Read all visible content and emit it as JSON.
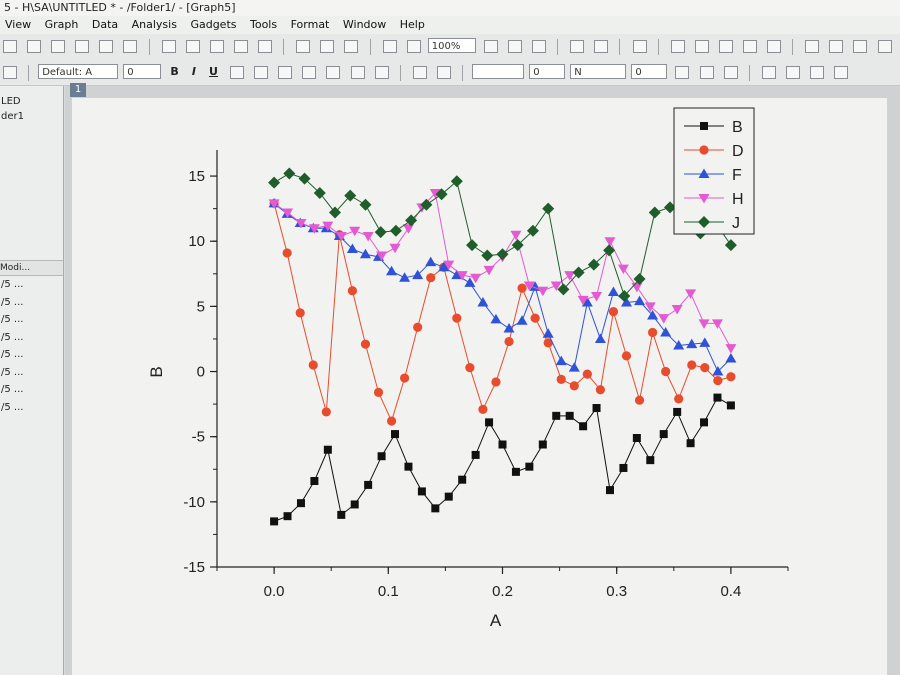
{
  "window": {
    "title": "5 - H\\SA\\UNTITLED * - /Folder1/ - [Graph5]"
  },
  "menu": [
    "View",
    "Graph",
    "Data",
    "Analysis",
    "Gadgets",
    "Tools",
    "Format",
    "Window",
    "Help"
  ],
  "toolbar": {
    "zoom": "100%",
    "font": "Default: A",
    "font_size": "0",
    "bold": "B",
    "italic": "I",
    "underline": "U",
    "line_style_value": "0",
    "line_width_value": "0",
    "color_value": "N"
  },
  "project_explorer": {
    "items": [
      "LED",
      "der1"
    ],
    "header": "Modi...",
    "rows": [
      "/5 ...",
      "/5 ...",
      "/5 ...",
      "/5 ...",
      "/5 ...",
      "/5 ...",
      "/5 ...",
      "/5 ..."
    ]
  },
  "graph": {
    "layer_tab": "1"
  },
  "chart_data": {
    "type": "scatter",
    "xlabel": "A",
    "ylabel": "B",
    "xlim": [
      -0.05,
      0.45
    ],
    "ylim": [
      -15,
      17
    ],
    "xticks": [
      0.0,
      0.1,
      0.2,
      0.3,
      0.4
    ],
    "xtick_labels": [
      "0.0",
      "0.1",
      "0.2",
      "0.3",
      "0.4"
    ],
    "yticks": [
      -15,
      -10,
      -5,
      0,
      5,
      10,
      15
    ],
    "ytick_labels": [
      "-15",
      "-10",
      "-5",
      "0",
      "5",
      "10",
      "15"
    ],
    "x": [
      0.0,
      0.0133,
      0.0267,
      0.04,
      0.0533,
      0.0667,
      0.08,
      0.0933,
      0.1067,
      0.12,
      0.1333,
      0.1467,
      0.16,
      0.1733,
      0.1867,
      0.2,
      0.2133,
      0.2267,
      0.24,
      0.2533,
      0.2667,
      0.28,
      0.2933,
      0.3067,
      0.32,
      0.3333,
      0.3467,
      0.36,
      0.3733,
      0.3867,
      0.4
    ],
    "legend_position": "top-right",
    "grid": false,
    "series": [
      {
        "name": "B",
        "color": "#111111",
        "marker": "square",
        "values": [
          -11.5,
          -11.1,
          -10.1,
          -8.4,
          -6.0,
          -11.0,
          -10.2,
          -8.7,
          -6.5,
          -4.8,
          -7.3,
          -9.2,
          -10.5,
          -9.6,
          -8.3,
          -6.4,
          -3.9,
          -5.6,
          -7.7,
          -7.3,
          -5.6,
          -3.4,
          -3.4,
          -4.2,
          -2.8,
          -9.1,
          -7.4,
          -5.1,
          -6.8,
          -4.8,
          -3.1,
          -5.5,
          -3.9,
          -2.0,
          -2.6
        ]
      },
      {
        "name": "D",
        "color": "#e74c2c",
        "marker": "circle",
        "values": [
          12.9,
          9.1,
          4.5,
          0.5,
          -3.1,
          10.5,
          6.2,
          2.1,
          -1.6,
          -3.8,
          -0.5,
          3.4,
          7.2,
          8.0,
          4.1,
          0.3,
          -2.9,
          -0.8,
          2.3,
          6.4,
          4.1,
          2.2,
          -0.6,
          -1.1,
          -0.2,
          -1.4,
          4.6,
          1.2,
          -2.2,
          3.0,
          0.0,
          -2.1,
          0.5,
          0.3,
          -0.7,
          -0.4
        ]
      },
      {
        "name": "F",
        "color": "#2f52d6",
        "marker": "triangle-up",
        "values": [
          12.9,
          12.1,
          11.4,
          11.0,
          11.0,
          10.4,
          9.4,
          9.0,
          8.8,
          7.7,
          7.2,
          7.4,
          8.4,
          8.0,
          7.4,
          6.8,
          5.3,
          4.0,
          3.3,
          3.9,
          6.5,
          2.9,
          0.8,
          0.3,
          5.3,
          2.5,
          6.1,
          5.3,
          5.4,
          4.3,
          3.0,
          2.0,
          2.1,
          2.2,
          0.0,
          1.0
        ]
      },
      {
        "name": "H",
        "color": "#e45ad0",
        "marker": "triangle-down",
        "values": [
          12.9,
          12.2,
          11.4,
          11.0,
          11.2,
          10.4,
          10.8,
          10.4,
          8.9,
          9.5,
          11.0,
          12.6,
          13.7,
          8.2,
          7.4,
          7.2,
          7.8,
          8.8,
          10.5,
          6.6,
          6.2,
          6.6,
          7.4,
          5.5,
          5.8,
          10.0,
          7.9,
          6.5,
          5.0,
          4.1,
          4.8,
          6.0,
          3.7,
          3.7,
          1.8
        ]
      },
      {
        "name": "J",
        "color": "#1f5d2b",
        "marker": "diamond",
        "values": [
          14.5,
          15.2,
          14.8,
          13.7,
          12.2,
          13.5,
          12.8,
          10.7,
          10.8,
          11.6,
          12.8,
          13.6,
          14.6,
          9.7,
          8.9,
          9.0,
          9.7,
          10.8,
          12.5,
          6.3,
          7.6,
          8.2,
          9.3,
          5.8,
          7.1,
          12.2,
          12.6,
          13.0,
          10.6,
          11.4,
          9.7
        ]
      }
    ]
  }
}
